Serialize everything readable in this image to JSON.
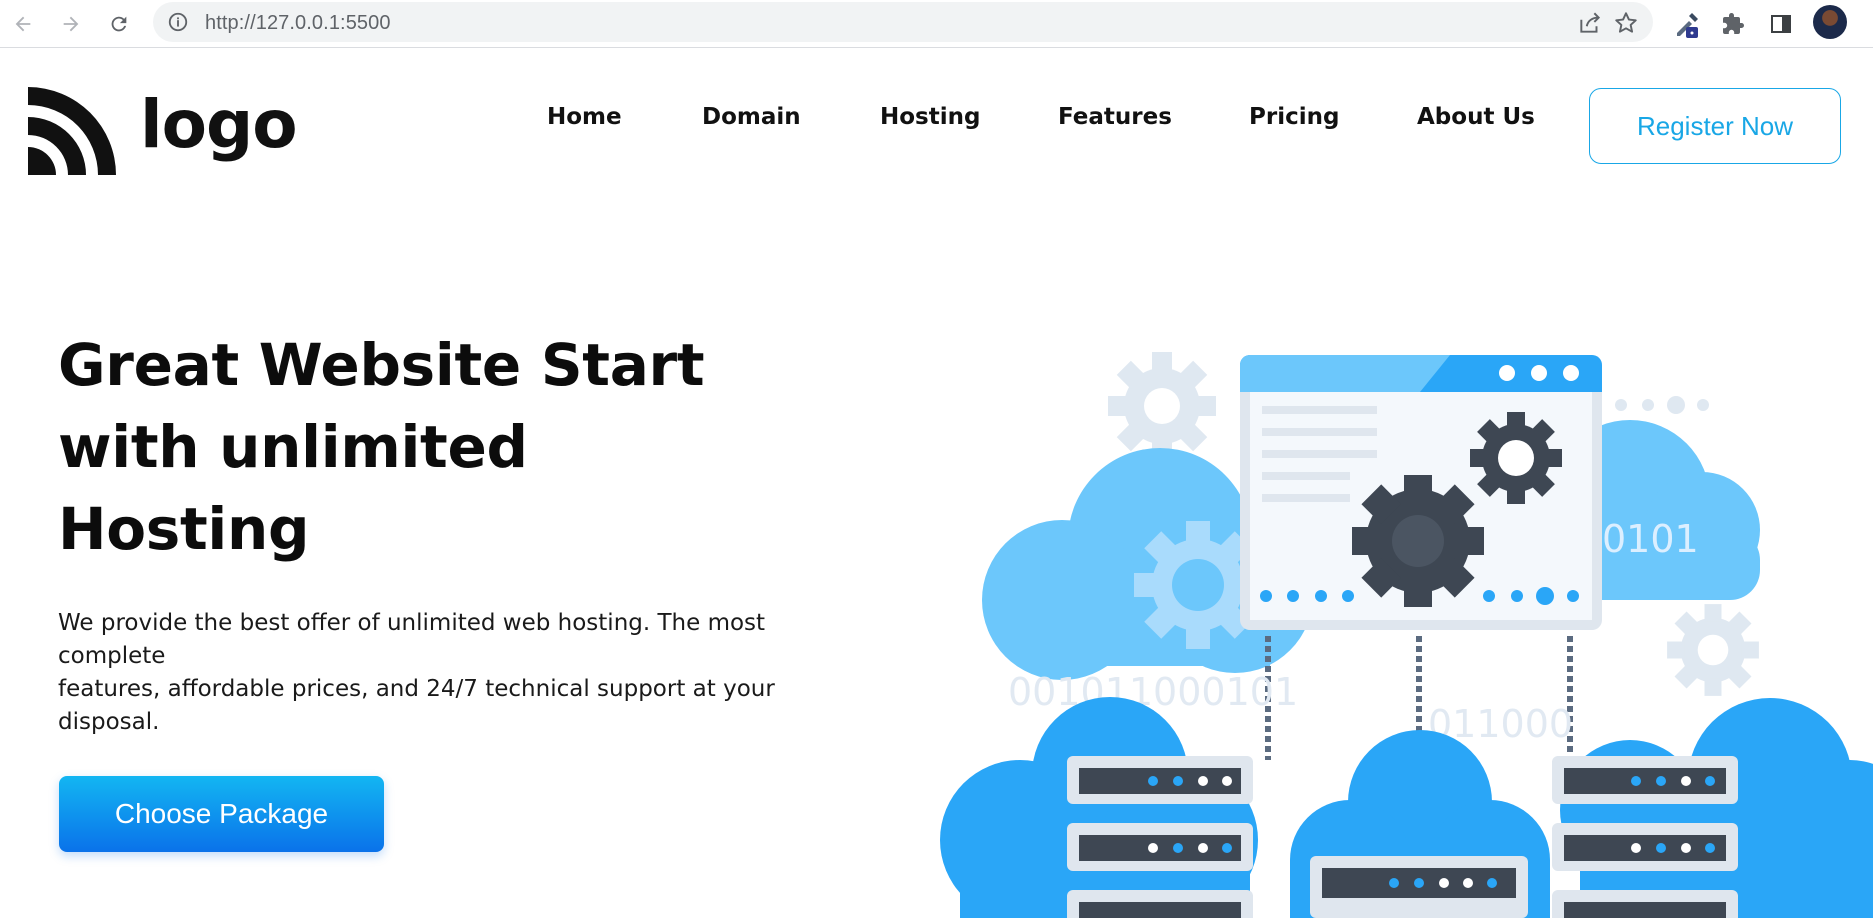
{
  "browser": {
    "url": "http://127.0.0.1:5500",
    "icons": [
      "back-icon",
      "forward-icon",
      "reload-icon",
      "info-icon",
      "share-icon",
      "star-icon",
      "eyedropper-extension-icon",
      "puzzle-extensions-icon",
      "side-panel-icon",
      "profile-avatar"
    ]
  },
  "header": {
    "logo_text": "logo",
    "nav": [
      "Home",
      "Domain",
      "Hosting",
      "Features",
      "Pricing",
      "About Us"
    ],
    "register_label": "Register Now"
  },
  "hero": {
    "title": "Great Website Start with unlimited Hosting",
    "description_lines": [
      "We provide the best offer of unlimited web hosting. The most",
      "complete",
      "features, affordable prices, and 24/7 technical support at your",
      "disposal."
    ],
    "cta_label": "Choose Package"
  },
  "illustration": {
    "binary_texts": [
      "0101",
      "001011000101",
      "011000"
    ]
  },
  "colors": {
    "accent": "#19a7e6",
    "cta_top": "#13b6f2",
    "cta_bottom": "#0a72ea",
    "cloud_light": "#6cc7fb",
    "cloud_main": "#2aa6f7",
    "gear_dark": "#3e4753"
  }
}
